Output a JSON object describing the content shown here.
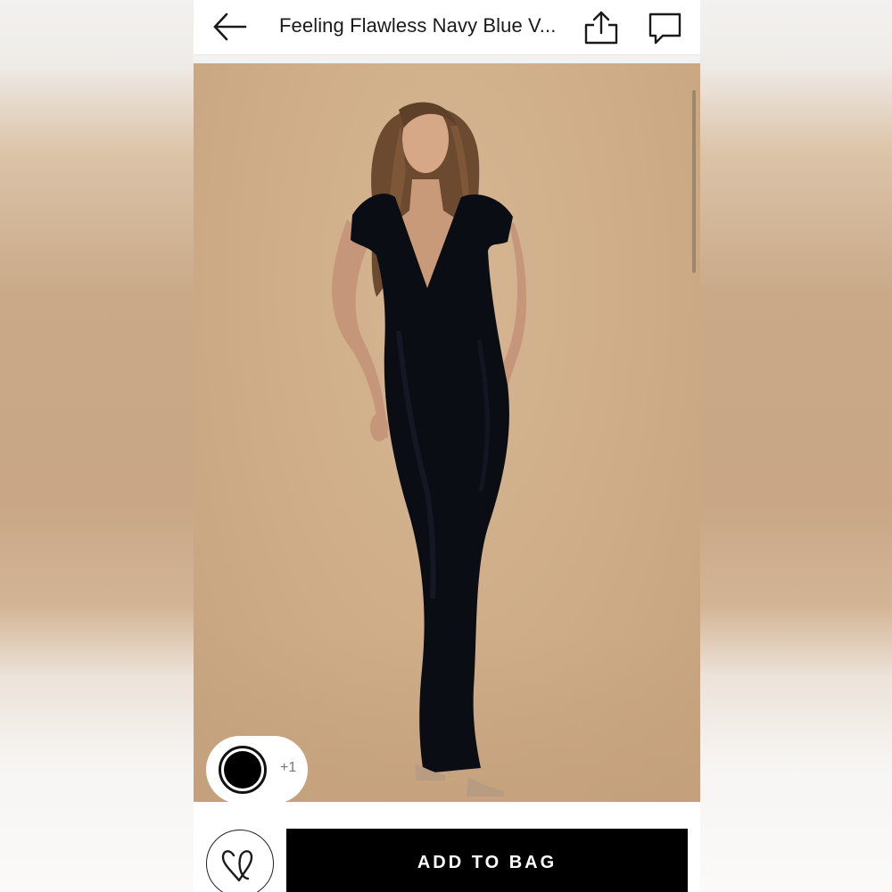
{
  "header": {
    "title": "Feeling Flawless Navy Blue V...",
    "back_icon": "arrow-left-icon",
    "share_icon": "share-upload-icon",
    "chat_icon": "chat-bubble-icon"
  },
  "product_image": {
    "description_icon": "product-photo",
    "background_color": "#d0af8a",
    "dress_color": "#0b0d14"
  },
  "color_selector": {
    "selected_color": "#000000",
    "more_colors_label": "+1"
  },
  "actions": {
    "like_icon": "heart-icon",
    "add_to_bag_label": "ADD TO BAG"
  }
}
